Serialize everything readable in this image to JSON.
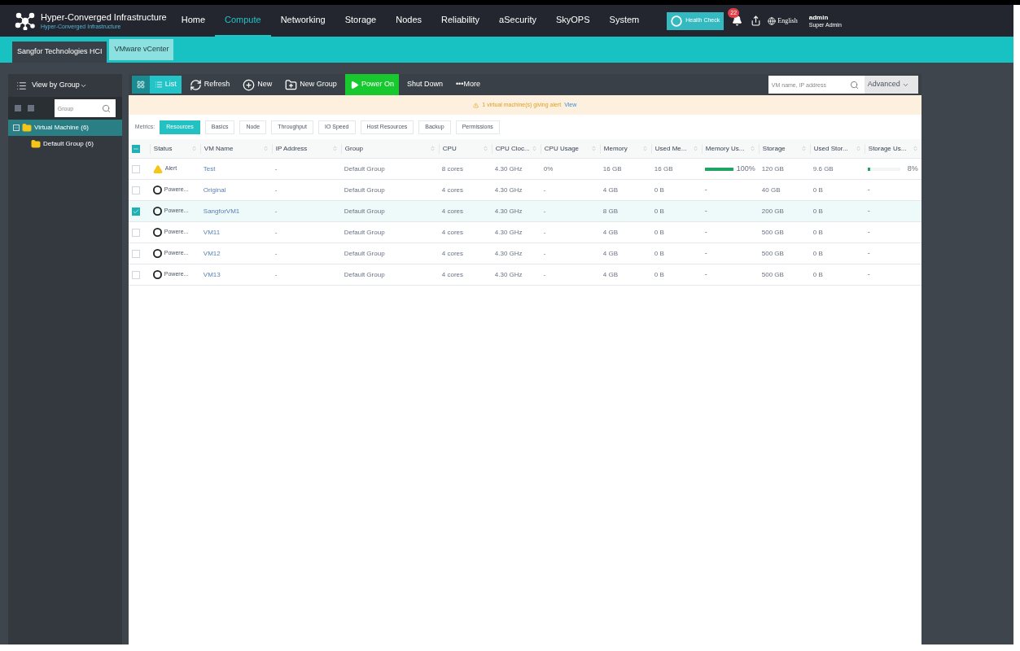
{
  "app": {
    "title": "Hyper-Converged Infrastructure",
    "subtitle": "Hyper-Converged Infrastructure"
  },
  "nav": [
    {
      "label": "Home",
      "selected": false
    },
    {
      "label": "Compute",
      "selected": true
    },
    {
      "label": "Networking",
      "selected": false
    },
    {
      "label": "Storage",
      "selected": false
    },
    {
      "label": "Nodes",
      "selected": false
    },
    {
      "label": "Reliability",
      "selected": false
    },
    {
      "label": "aSecurity",
      "selected": false
    },
    {
      "label": "SkyOPS",
      "selected": false
    },
    {
      "label": "System",
      "selected": false
    }
  ],
  "header": {
    "health_check": "Health Check",
    "alert_count": "22",
    "language": "English",
    "user": "admin",
    "role": "Super Admin"
  },
  "platform_tabs": [
    {
      "label": "Sangfor Technologies HCI",
      "selected": true
    },
    {
      "label": "VMware vCenter",
      "selected": false
    }
  ],
  "sidebar": {
    "view_label": "View by Group",
    "search_placeholder": "Group",
    "tree": [
      {
        "label": "Virtual Machine (6)",
        "selected": true,
        "expanded": true,
        "children": [
          {
            "label": "Default Group (6)",
            "selected": false
          }
        ]
      }
    ]
  },
  "toolbar": {
    "view_modes": [
      {
        "kind": "grid",
        "selected": false
      },
      {
        "kind": "list",
        "label": "List",
        "selected": true
      }
    ],
    "actions": [
      {
        "kind": "refresh",
        "label": "Refresh",
        "highlighted": false
      },
      {
        "kind": "new",
        "label": "New",
        "highlighted": false
      },
      {
        "kind": "new-group",
        "label": "New Group",
        "highlighted": false
      },
      {
        "kind": "play",
        "label": "Power On",
        "highlighted": true
      },
      {
        "kind": "plain",
        "label": "Shut Down",
        "highlighted": false
      },
      {
        "kind": "more",
        "label": "•••More",
        "highlighted": false
      }
    ],
    "search_placeholder": "VM name, IP address",
    "advanced": "Advanced"
  },
  "alert_banner": {
    "text": "1 virtual machine(s) giving alert",
    "link": "View"
  },
  "metrics": {
    "label": "Metrics:",
    "tabs": [
      {
        "label": "Resources",
        "selected": true
      },
      {
        "label": "Basics",
        "selected": false
      },
      {
        "label": "Node",
        "selected": false
      },
      {
        "label": "Throughput",
        "selected": false
      },
      {
        "label": "IO Speed",
        "selected": false
      },
      {
        "label": "Host Resources",
        "selected": false
      },
      {
        "label": "Backup",
        "selected": false
      },
      {
        "label": "Permissions",
        "selected": false
      }
    ]
  },
  "table": {
    "select_all": {
      "indeterminate": true
    },
    "columns": [
      "Status",
      "VM Name",
      "IP Address",
      "Group",
      "CPU",
      "CPU Cloc...",
      "CPU Usage",
      "Memory",
      "Used Me...",
      "Memory Us...",
      "Storage",
      "Used Stor...",
      "Storage Us..."
    ],
    "rows": [
      {
        "checked": false,
        "status": {
          "kind": "alert",
          "label": "Alert"
        },
        "name": "Test",
        "ip": "-",
        "group": "Default Group",
        "cpu": "8 cores",
        "clock": "4.30 GHz",
        "cpu_usage": "0%",
        "memory": "16 GB",
        "used_memory": "16 GB",
        "memory_usage": {
          "level": 1,
          "reading": "100%"
        },
        "storage": "120 GB",
        "used_storage": "9.6 GB",
        "storage_usage": {
          "level": 0.08,
          "reading": "8%"
        }
      },
      {
        "checked": false,
        "status": {
          "kind": "off",
          "label": "Powere..."
        },
        "name": "Original",
        "ip": "-",
        "group": "Default Group",
        "cpu": "4 cores",
        "clock": "4.30 GHz",
        "cpu_usage": "-",
        "memory": "4 GB",
        "used_memory": "0 B",
        "memory_usage": {
          "reading": "-"
        },
        "storage": "40 GB",
        "used_storage": "0 B",
        "storage_usage": {
          "reading": "-"
        }
      },
      {
        "checked": true,
        "status": {
          "kind": "off",
          "label": "Powere..."
        },
        "name": "SangforVM1",
        "ip": "-",
        "group": "Default Group",
        "cpu": "4 cores",
        "clock": "4.30 GHz",
        "cpu_usage": "-",
        "memory": "8 GB",
        "used_memory": "0 B",
        "memory_usage": {
          "reading": "-"
        },
        "storage": "200 GB",
        "used_storage": "0 B",
        "storage_usage": {
          "reading": "-"
        }
      },
      {
        "checked": false,
        "status": {
          "kind": "off",
          "label": "Powere..."
        },
        "name": "VM11",
        "ip": "-",
        "group": "Default Group",
        "cpu": "4 cores",
        "clock": "4.30 GHz",
        "cpu_usage": "-",
        "memory": "4 GB",
        "used_memory": "0 B",
        "memory_usage": {
          "reading": "-"
        },
        "storage": "500 GB",
        "used_storage": "0 B",
        "storage_usage": {
          "reading": "-"
        }
      },
      {
        "checked": false,
        "status": {
          "kind": "off",
          "label": "Powere..."
        },
        "name": "VM12",
        "ip": "-",
        "group": "Default Group",
        "cpu": "4 cores",
        "clock": "4.30 GHz",
        "cpu_usage": "-",
        "memory": "4 GB",
        "used_memory": "0 B",
        "memory_usage": {
          "reading": "-"
        },
        "storage": "500 GB",
        "used_storage": "0 B",
        "storage_usage": {
          "reading": "-"
        }
      },
      {
        "checked": false,
        "status": {
          "kind": "off",
          "label": "Powere..."
        },
        "name": "VM13",
        "ip": "-",
        "group": "Default Group",
        "cpu": "4 cores",
        "clock": "4.30 GHz",
        "cpu_usage": "-",
        "memory": "4 GB",
        "used_memory": "0 B",
        "memory_usage": {
          "reading": "-"
        },
        "storage": "500 GB",
        "used_storage": "0 B",
        "storage_usage": {
          "reading": "-"
        }
      }
    ]
  }
}
